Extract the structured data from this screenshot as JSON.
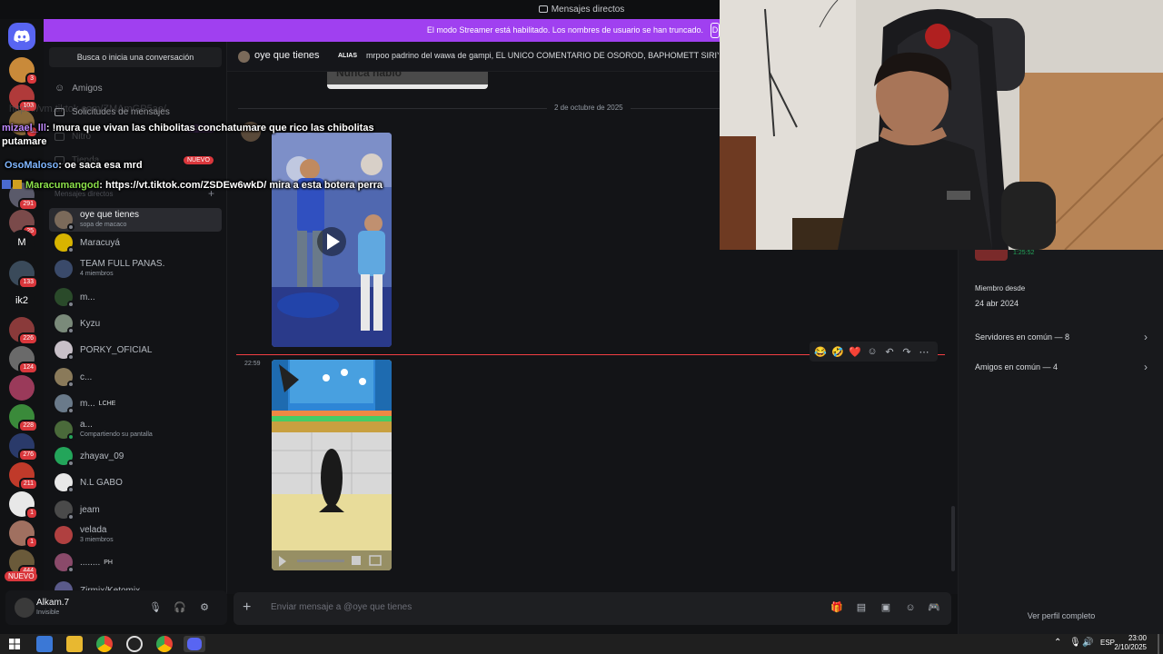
{
  "app": {
    "window_title": "Mensajes directos",
    "streamer_banner": "El modo Streamer está habilitado. Los nombres de usuario se han truncado.",
    "streamer_banner_button": "D"
  },
  "colors": {
    "brand": "#5865f2",
    "banner": "#a040f0",
    "badge_red": "#da373c",
    "new_line": "#f23f43",
    "online_green": "#23a55a"
  },
  "server_rail": {
    "badges": [
      "3",
      "103",
      "3",
      "291",
      "25",
      "133",
      "226",
      "124",
      "228",
      "276",
      "211",
      "1",
      "1",
      "444"
    ],
    "letter_servers": [
      "M",
      "ik2"
    ],
    "new_badge": "NUEVO"
  },
  "sidebar": {
    "search_placeholder": "Busca o inicia una conversación",
    "nav": [
      {
        "label": "Amigos",
        "badge": ""
      },
      {
        "label": "Solicitudes de mensajes",
        "badge": ""
      },
      {
        "label": "Nitro",
        "badge": "NUEVO"
      },
      {
        "label": "Tienda",
        "badge": "NUEVO"
      }
    ],
    "dm_header": "Mensajes directos",
    "dms": [
      {
        "name": "oye que tienes",
        "sub": "sopa de macaco",
        "tag": "",
        "color": "#7b6a5a",
        "status": "#80848e"
      },
      {
        "name": "Maracuyá",
        "sub": "",
        "tag": "",
        "color": "#d8b400",
        "status": "#80848e"
      },
      {
        "name": "TEAM FULL PANAS.",
        "sub": "4 miembros",
        "tag": "",
        "color": "#3a4a6a",
        "status": ""
      },
      {
        "name": "m...",
        "sub": "",
        "tag": "",
        "color": "#2a4a2a",
        "status": "#80848e"
      },
      {
        "name": "Kyzu",
        "sub": "",
        "tag": "",
        "color": "#7a8a7a",
        "status": "#80848e"
      },
      {
        "name": "PORKY_OFICIAL",
        "sub": "",
        "tag": "",
        "color": "#c8c0c8",
        "status": "#80848e"
      },
      {
        "name": "c...",
        "sub": "",
        "tag": "",
        "color": "#8a7a5a",
        "status": "#80848e"
      },
      {
        "name": "m...",
        "sub": "",
        "tag": "LCHE",
        "color": "#6a7a8a",
        "status": "#80848e"
      },
      {
        "name": "a...",
        "sub": "Compartiendo su pantalla",
        "tag": "",
        "color": "#4a6a3a",
        "status": "#23a55a"
      },
      {
        "name": "zhayav_09",
        "sub": "",
        "tag": "",
        "color": "#23a55a",
        "status": "#80848e"
      },
      {
        "name": "N.L GABO",
        "sub": "",
        "tag": "",
        "color": "#e8e8e8",
        "status": "#80848e"
      },
      {
        "name": "jeam",
        "sub": "",
        "tag": "",
        "color": "#4a4a4a",
        "status": "#80848e"
      },
      {
        "name": "velada",
        "sub": "3 miembros",
        "tag": "",
        "color": "#b04040",
        "status": ""
      },
      {
        "name": "........",
        "sub": "",
        "tag": "PH",
        "color": "#8a4a6a",
        "status": "#80848e"
      },
      {
        "name": "Zirmix/Ketomix",
        "sub": "",
        "tag": "",
        "color": "#5a5a8a",
        "status": "#80848e"
      }
    ]
  },
  "user_panel": {
    "name": "Alkam.7",
    "status": "Invisible"
  },
  "chat_header": {
    "name": "oye que tienes",
    "alias_label": "ALIAS",
    "alias_text": "mrpoo padrino del wawa de gampi, EL UNICO COMENTARIO DE OSOROD, BAPHOMETT SIRIYS"
  },
  "messages": {
    "preview_text": "Nunca hablo",
    "date_divider": "2 de octubre de 2025",
    "timestamp": "22:59"
  },
  "composer": {
    "placeholder": "Enviar mensaje a @oye que tienes"
  },
  "profile": {
    "game_time": "1:25:52",
    "member_since_label": "Miembro desde",
    "member_since_date": "24 abr 2024",
    "servers_in_common": "Servidores en común — 8",
    "friends_in_common": "Amigos en común — 4",
    "full_profile": "Ver perfil completo"
  },
  "chat_overlay": {
    "ghost_link": "https://vm.tiktok.com/ZMAmGP5ae/",
    "lines": [
      {
        "user": "mizael_lll",
        "text": ": !mura que vivan las chibolitas conchatumare que rico las chibolitas putamare",
        "color": "#c08aff"
      },
      {
        "user": "OsoMaloso",
        "text": ": oe saca esa mrd",
        "color": "#7fb6ff"
      },
      {
        "user": "Maracumangod",
        "text": ": https://vt.tiktok.com/ZSDEw6wkD/ mira a esta botera perra",
        "color": "#8be04a"
      }
    ]
  },
  "taskbar": {
    "time": "23:00",
    "date": "2/10/2025",
    "lang": "ESP"
  }
}
